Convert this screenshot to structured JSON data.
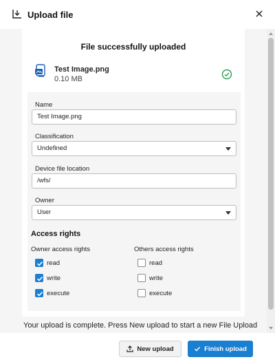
{
  "header": {
    "title": "Upload file",
    "upload_icon": "upload-file-icon",
    "close_icon": "close-icon"
  },
  "status": {
    "title": "File successfully uploaded",
    "message": "Your upload is complete. Press New upload to start a new File Upload"
  },
  "file": {
    "name": "Test Image.png",
    "size": "0.10 MB",
    "icon": "image-file-icon",
    "status_icon": "check-circle-icon"
  },
  "form": {
    "name_label": "Name",
    "name_value": "Test Image.png",
    "classification_label": "Classification",
    "classification_value": "Undefined",
    "location_label": "Device file location",
    "location_value": "/wfs/",
    "owner_label": "Owner",
    "owner_value": "User"
  },
  "access": {
    "title": "Access rights",
    "owner_title": "Owner access rights",
    "others_title": "Others access rights",
    "owner": [
      {
        "label": "read",
        "checked": true
      },
      {
        "label": "write",
        "checked": true
      },
      {
        "label": "execute",
        "checked": true
      }
    ],
    "others": [
      {
        "label": "read",
        "checked": false
      },
      {
        "label": "write",
        "checked": false
      },
      {
        "label": "execute",
        "checked": false
      }
    ]
  },
  "buttons": {
    "new_upload": "New upload",
    "finish_upload": "Finish upload"
  },
  "colors": {
    "accent": "#1a7ed1",
    "success": "#2e9e52",
    "panel": "#f5f5f5"
  }
}
